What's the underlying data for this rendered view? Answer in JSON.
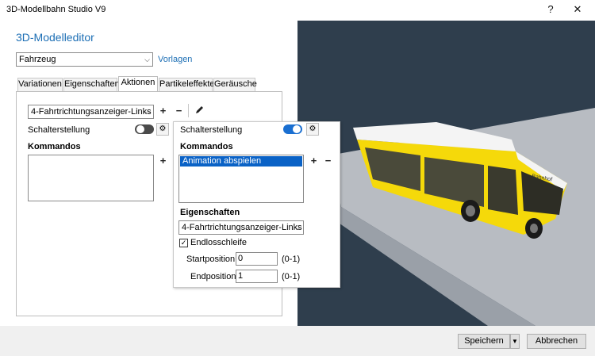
{
  "window": {
    "title": "3D-Modellbahn Studio V9",
    "help_icon": "?",
    "close_icon": "✕"
  },
  "editor": {
    "heading": "3D-Modelleditor",
    "model_select": "Fahrzeug",
    "templates_link": "Vorlagen"
  },
  "tabs": [
    {
      "label": "Variationen"
    },
    {
      "label": "Eigenschaften"
    },
    {
      "label": "Aktionen"
    },
    {
      "label": "Partikeleffekte"
    },
    {
      "label": "Geräusche"
    }
  ],
  "actions": {
    "action_select": "4-Fahrtrichtungsanzeiger-Links",
    "add": "+",
    "remove": "−",
    "switch_label": "Schalterstellung",
    "commands_label": "Kommandos",
    "command_add": "+"
  },
  "popup": {
    "switch_label": "Schalterstellung",
    "commands_label": "Kommandos",
    "commands": [
      "Animation abspielen"
    ],
    "add": "+",
    "remove": "−",
    "properties_label": "Eigenschaften",
    "property_select": "4-Fahrtrichtungsanzeiger-Links",
    "loop_label": "Endlosschleife",
    "loop_checked": "✓",
    "start_label": "Startposition:",
    "start_value": "0",
    "start_range": "(0-1)",
    "end_label": "Endposition:",
    "end_value": "1",
    "end_range": "(0-1)"
  },
  "footer": {
    "save_label": "Speichern",
    "cancel_label": "Abbrechen"
  },
  "colors": {
    "accent": "#1d6fb5",
    "toggle_on": "#1a6fd1",
    "selection": "#0a62c6",
    "viewport_bg": "#2f3e4d",
    "bus_yellow": "#f5d90a"
  }
}
